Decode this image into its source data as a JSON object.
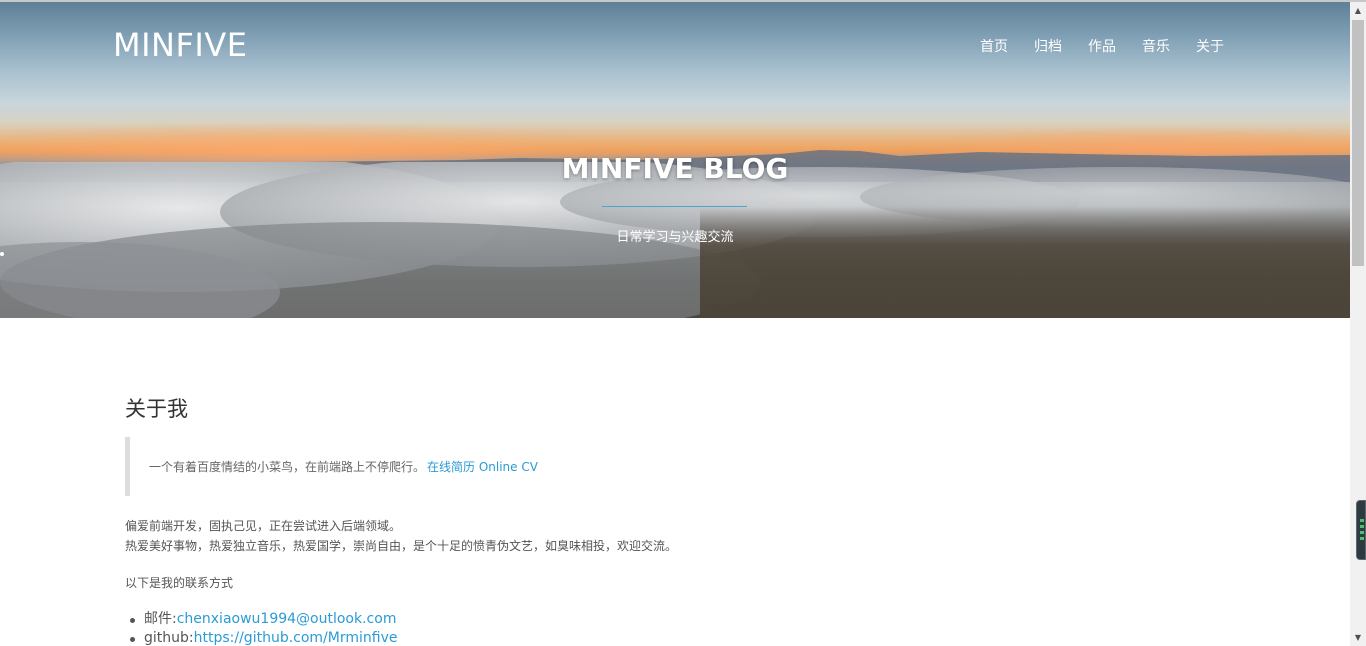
{
  "brand": "MINFIVE",
  "nav": {
    "items": [
      "首页",
      "归档",
      "作品",
      "音乐",
      "关于"
    ]
  },
  "hero": {
    "title": "MINFIVE BLOG",
    "subtitle": "日常学习与兴趣交流"
  },
  "about": {
    "heading": "关于我",
    "quote_text": "一个有着百度情结的小菜鸟，在前端路上不停爬行。",
    "quote_link": "在线简历 Online CV",
    "para_line1": "偏爱前端开发，固执己见，正在尝试进入后端领域。",
    "para_line2": "热爱美好事物，热爱独立音乐，热爱国学，崇尚自由，是个十足的愤青伪文艺，如臭味相投，欢迎交流。",
    "contact_intro": "以下是我的联系方式",
    "contacts": [
      {
        "label": "邮件:",
        "value": "chenxiaowu1994@outlook.com"
      },
      {
        "label": "github:",
        "value": "https://github.com/Mrminfive"
      }
    ]
  },
  "colors": {
    "accent": "#2a9bd6",
    "hero_divider": "#4aa6cf",
    "quote_border": "#dddddd"
  },
  "icons": {
    "scroll_up": "chevron-up-icon",
    "scroll_down": "chevron-down-icon"
  }
}
